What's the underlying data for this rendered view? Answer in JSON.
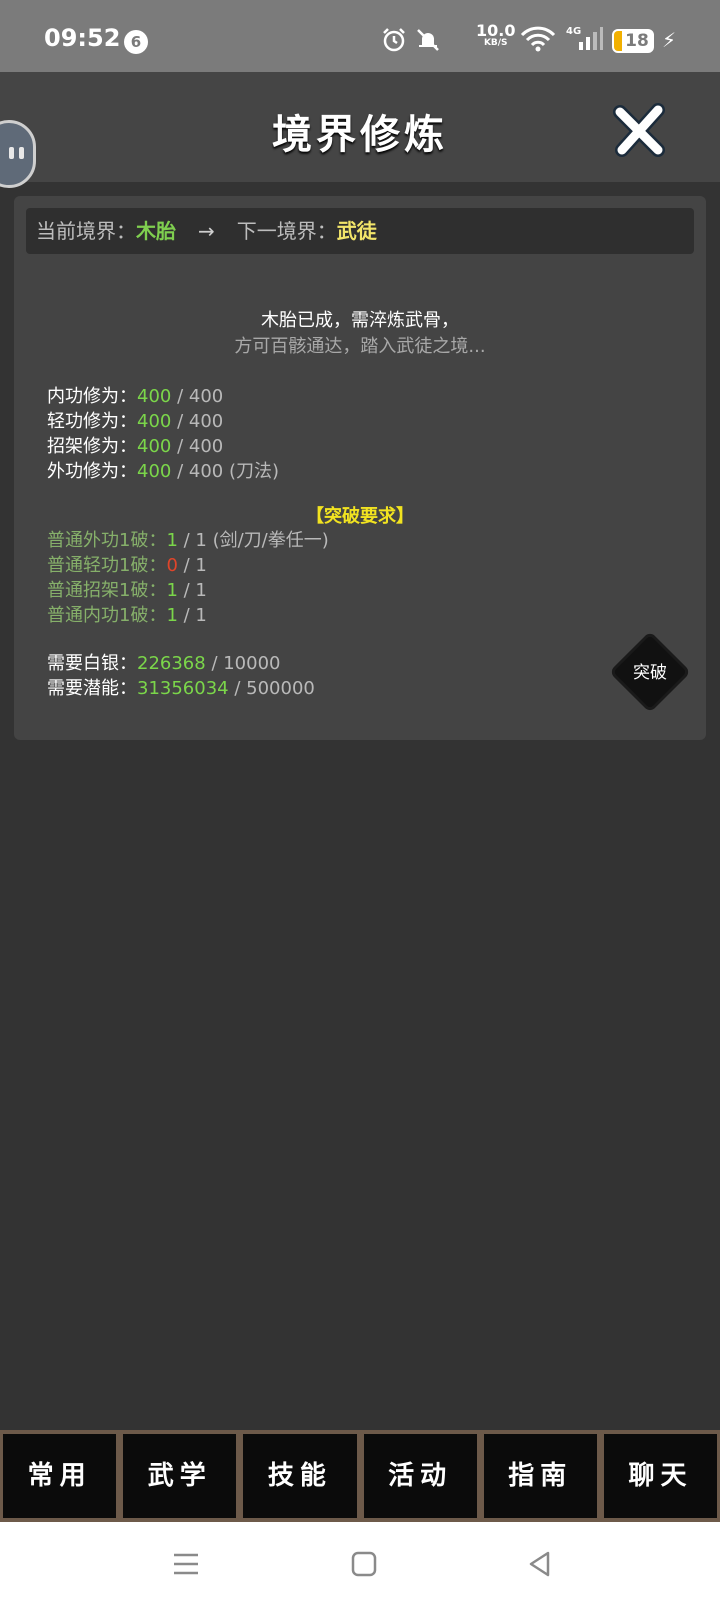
{
  "status_bar": {
    "time": "09:52",
    "notif_count": "6",
    "speed_value": "10.0",
    "speed_unit": "KB/S",
    "network": "4G",
    "battery": "18",
    "icons": [
      "alarm-icon",
      "mute-icon",
      "wifi-icon",
      "signal-icon",
      "charging-icon"
    ]
  },
  "header": {
    "title": "境界修炼",
    "close_icon": "close-x-icon"
  },
  "realm": {
    "current_label": "当前境界：",
    "current_value": "木胎",
    "arrow": "→",
    "next_label": "下一境界：",
    "next_value": "武徒"
  },
  "description": {
    "line1": "木胎已成，需淬炼武骨，",
    "line2": "方可百骸通达，踏入武徒之境..."
  },
  "stats": [
    {
      "label": "内功修为：",
      "value": "400",
      "max": " / 400",
      "note": ""
    },
    {
      "label": "轻功修为：",
      "value": "400",
      "max": " / 400",
      "note": ""
    },
    {
      "label": "招架修为：",
      "value": "400",
      "max": " / 400",
      "note": ""
    },
    {
      "label": "外功修为：",
      "value": "400",
      "max": " / 400",
      "note": " (刀法)"
    }
  ],
  "requirements": {
    "title": "【突破要求】",
    "items": [
      {
        "label": "普通外功1破：",
        "value": "1",
        "max": " / 1 (剑/刀/拳任一)",
        "met": true
      },
      {
        "label": "普通轻功1破：",
        "value": "0",
        "max": " / 1",
        "met": false
      },
      {
        "label": "普通招架1破：",
        "value": "1",
        "max": " / 1",
        "met": true
      },
      {
        "label": "普通内功1破：",
        "value": "1",
        "max": " / 1",
        "met": true
      }
    ]
  },
  "costs": [
    {
      "label": "需要白银：",
      "value": "226368",
      "max": " / 10000"
    },
    {
      "label": "需要潜能：",
      "value": "31356034",
      "max": " / 500000"
    }
  ],
  "breakthrough_button": "突破",
  "bottom_nav": [
    "常用",
    "武学",
    "技能",
    "活动",
    "指南",
    "聊天"
  ],
  "colors": {
    "accent_green": "#7bd64a",
    "warning_red": "#e0452a",
    "next_realm_yellow": "#f2e56a",
    "requirement_title": "#f2e320"
  }
}
